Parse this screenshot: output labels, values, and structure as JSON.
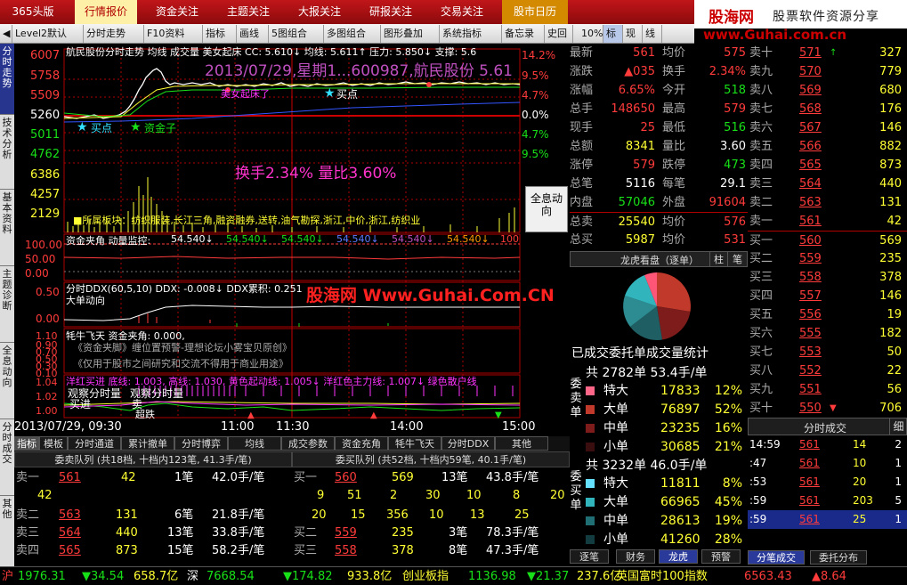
{
  "menu": [
    "365头版",
    "行情报价",
    "资金关注",
    "主题关注",
    "大报关注",
    "研报关注",
    "交易关注",
    "股市日历"
  ],
  "brand": {
    "cn": "股海网",
    "tag": "股票软件资源分享",
    "url": "www.Guhai.com.cn"
  },
  "toolbar": [
    "Level2默认",
    "分时走势",
    "F10资料",
    "指标",
    "画线",
    "5图组合",
    "多图组合",
    "图形叠加",
    "系统指标",
    "备忘录",
    "史回",
    "10%",
    "标",
    "现",
    "线"
  ],
  "left_tabs": [
    "分时走势",
    "技术分析",
    "基本资料",
    "主题诊断",
    "全息动向",
    "分时成交",
    "其他"
  ],
  "chart": {
    "header": "航民股份分时走势  均线  成交量  美女起床  CC: 5.610↓  均线: 5.611↑  压力: 5.850↓  支撑: 5.6",
    "date_line": "2013/07/29,星期1...600987,航民股份 5.61",
    "turnover_text": "换手2.34%  量比3.60%",
    "sector_text": "■所属板块：纺织服装,长江三角,融资融券,送转,油气勘探,浙江,中价,浙江,纺织业",
    "left_scale": [
      "6007",
      "5758",
      "5509",
      "5260",
      "5011",
      "4762",
      "6386",
      "4257",
      "2129"
    ],
    "right_scale": [
      "14.2%",
      "9.5%",
      "4.7%",
      "0.0%",
      "4.7%",
      "9.5%"
    ],
    "annotations": {
      "wake": "美女起床了",
      "buy": "买点",
      "buy2": "买点",
      "gold": "资金子"
    },
    "fund_angle": {
      "title": "资金夹角  动量监控:",
      "vals": [
        "54.540↓",
        "54.540↓",
        "54.540↓",
        "54.540↓",
        "54.540↓",
        "54.540↓"
      ],
      "end": "100",
      "scale": [
        "100.00",
        "50.00",
        "0.00"
      ]
    },
    "ddx": {
      "title": "分时DDX(60,5,10) DDX: -0.008↓ DDX累积: 0.251",
      "sub": "大单动向",
      "scale": [
        "0.50",
        "0.00"
      ]
    },
    "niu": {
      "title": "牦牛飞天  资金夹角: 0.000,",
      "line1": "《资金夹脚》缠位置预警-理想论坛小雾宝贝原创》",
      "line2": "《仅用于股市之间研究和交流不得用于商业用途》",
      "scale": [
        "1.10",
        "0.90",
        "0.70",
        "0.50",
        "0.30",
        "0.10"
      ]
    },
    "yang": {
      "title": "洋红买进  底线: 1.003,  高线: 1.030,  黄色起动线: 1.005↓  洋红色主力线: 1.007↓  绿色散户线",
      "buy": "买进",
      "buy2": "卖",
      "label1": "观察分时量",
      "label2": "观察分时量",
      "note": "超跌",
      "scale": [
        "1.04",
        "1.02",
        "1.00"
      ]
    },
    "time_axis": [
      "2013/07/29, 09:30",
      "11:00",
      "11:30",
      "14:00",
      "15:00"
    ],
    "quanxi": "全息动向",
    "watermark": "股海网 Www.Guhai.Com.CN"
  },
  "indicator_tabs": [
    "指标",
    "模板",
    "分时通道",
    "累计撤单",
    "分时博弈",
    "均线",
    "成交参数",
    "资金充角",
    "牦牛飞天",
    "分时DDX",
    "其他"
  ],
  "quote": [
    {
      "l1": "最新",
      "v1": "561",
      "l2": "均价",
      "v2": "575"
    },
    {
      "l1": "涨跌",
      "v1": "▲035",
      "l2": "换手",
      "v2": "2.34%"
    },
    {
      "l1": "涨幅",
      "v1": "6.65%",
      "l2": "今开",
      "v2": "518"
    },
    {
      "l1": "总手",
      "v1": "148650",
      "l2": "最高",
      "v2": "579"
    },
    {
      "l1": "现手",
      "v1": "25",
      "l2": "最低",
      "v2": "516"
    },
    {
      "l1": "总额",
      "v1": "8341",
      "l2": "量比",
      "v2": "3.60"
    },
    {
      "l1": "涨停",
      "v1": "579",
      "l2": "跌停",
      "v2": "473"
    },
    {
      "l1": "总笔",
      "v1": "5116",
      "l2": "每笔",
      "v2": "29.1"
    },
    {
      "l1": "内盘",
      "v1": "57046",
      "l2": "外盘",
      "v2": "91604"
    },
    {
      "l1": "总卖",
      "v1": "25540",
      "l2": "均价",
      "v2": "576"
    },
    {
      "l1": "总买",
      "v1": "5987",
      "l2": "均价",
      "v2": "531"
    }
  ],
  "dragon": {
    "title": "龙虎看盘（逐单）",
    "tabs": [
      "柱",
      "笔"
    ],
    "caption": "已成交委托单成交量统计"
  },
  "sell_stats": {
    "header": "共 2782单 53.4手/单",
    "side": "委卖单",
    "rows": [
      {
        "n": "特大",
        "v": "17833",
        "p": "12%"
      },
      {
        "n": "大单",
        "v": "76897",
        "p": "52%"
      },
      {
        "n": "中单",
        "v": "23235",
        "p": "16%"
      },
      {
        "n": "小单",
        "v": "30685",
        "p": "21%"
      }
    ]
  },
  "buy_stats": {
    "header": "共 3232单 46.0手/单",
    "side": "委买单",
    "rows": [
      {
        "n": "特大",
        "v": "11811",
        "p": "8%"
      },
      {
        "n": "大单",
        "v": "66965",
        "p": "45%"
      },
      {
        "n": "中单",
        "v": "28613",
        "p": "19%"
      },
      {
        "n": "小单",
        "v": "41260",
        "p": "28%"
      }
    ]
  },
  "right_tabs": [
    "逐笔",
    "财务",
    "龙虎",
    "预警"
  ],
  "orderbook": [
    {
      "n": "卖十",
      "p": "571",
      "v": "327",
      "a": "↑"
    },
    {
      "n": "卖九",
      "p": "570",
      "v": "779",
      "a": ""
    },
    {
      "n": "卖八",
      "p": "569",
      "v": "680",
      "a": ""
    },
    {
      "n": "卖七",
      "p": "568",
      "v": "176",
      "a": ""
    },
    {
      "n": "卖六",
      "p": "567",
      "v": "146",
      "a": ""
    },
    {
      "n": "卖五",
      "p": "566",
      "v": "882",
      "a": ""
    },
    {
      "n": "卖四",
      "p": "565",
      "v": "873",
      "a": ""
    },
    {
      "n": "卖三",
      "p": "564",
      "v": "440",
      "a": ""
    },
    {
      "n": "卖二",
      "p": "563",
      "v": "131",
      "a": ""
    },
    {
      "n": "卖一",
      "p": "561",
      "v": "42",
      "a": ""
    },
    {
      "n": "买一",
      "p": "560",
      "v": "569",
      "a": ""
    },
    {
      "n": "买二",
      "p": "559",
      "v": "235",
      "a": ""
    },
    {
      "n": "买三",
      "p": "558",
      "v": "378",
      "a": ""
    },
    {
      "n": "买四",
      "p": "557",
      "v": "146",
      "a": ""
    },
    {
      "n": "买五",
      "p": "556",
      "v": "19",
      "a": ""
    },
    {
      "n": "买六",
      "p": "555",
      "v": "182",
      "a": ""
    },
    {
      "n": "买七",
      "p": "553",
      "v": "50",
      "a": ""
    },
    {
      "n": "买八",
      "p": "552",
      "v": "22",
      "a": ""
    },
    {
      "n": "买九",
      "p": "551",
      "v": "56",
      "a": ""
    },
    {
      "n": "买十",
      "p": "550",
      "v": "706",
      "a": "▼"
    }
  ],
  "tick": {
    "title": "分时成交",
    "btn": "细",
    "rows": [
      {
        "t": "14:59",
        "p": "561",
        "v": "14",
        "n": "2"
      },
      {
        "t": ":47",
        "p": "561",
        "v": "10",
        "n": "1"
      },
      {
        "t": ":53",
        "p": "561",
        "v": "20",
        "n": "1"
      },
      {
        "t": ":59",
        "p": "561",
        "v": "203",
        "n": "5"
      },
      {
        "t": ":59",
        "p": "561",
        "v": "25",
        "n": "1"
      }
    ],
    "tabs": [
      "分笔成交",
      "委托分布"
    ]
  },
  "sell_queue": {
    "title": "委卖队列 (共18档, 十档内123笔, 41.3手/笔)",
    "rows": [
      {
        "n": "卖一",
        "p": "561",
        "v": "42",
        "c": "1笔",
        "a": "42.0手/笔",
        "extra": "42"
      },
      {
        "n": "卖二",
        "p": "563",
        "v": "131",
        "c": "6笔",
        "a": "21.8手/笔"
      },
      {
        "n": "卖三",
        "p": "564",
        "v": "440",
        "c": "13笔",
        "a": "33.8手/笔"
      },
      {
        "n": "卖四",
        "p": "565",
        "v": "873",
        "c": "15笔",
        "a": "58.2手/笔"
      }
    ]
  },
  "buy_queue": {
    "title": "委买队列 (共52档, 十档内59笔, 40.1手/笔)",
    "rows": [
      {
        "n": "买一",
        "p": "560",
        "v": "569",
        "c": "13笔",
        "a": "43.8手/笔"
      },
      {
        "n": "买二",
        "p": "559",
        "v": "235",
        "c": "3笔",
        "a": "78.3手/笔"
      },
      {
        "n": "买三",
        "p": "558",
        "v": "378",
        "c": "8笔",
        "a": "47.3手/笔"
      }
    ],
    "detail1": [
      "9",
      "51",
      "2",
      "30",
      "10",
      "8",
      "20"
    ],
    "detail2": [
      "20",
      "15",
      "356",
      "10",
      "13",
      "25"
    ]
  },
  "statusbar": {
    "sh": "沪",
    "sh_idx": "1976.31",
    "sh_chg": "▼34.54",
    "sh_amt": "658.7亿",
    "sz": "深",
    "sz_idx": "7668.54",
    "sz_chg": "▼174.82",
    "sz_amt": "933.8亿",
    "cyb": "创业板指",
    "cyb_idx": "1136.98",
    "cyb_chg": "▼21.37",
    "cyb_amt": "237.6亿",
    "ftse": "英国富时100指数",
    "ftse_idx": "6563.43",
    "ftse_chg": "▲8.64"
  },
  "colors": {
    "menu_bg": "#c0161a",
    "up": "#ff3b3b",
    "down": "#18e018",
    "border": "#b00000",
    "panel": "#000000"
  }
}
